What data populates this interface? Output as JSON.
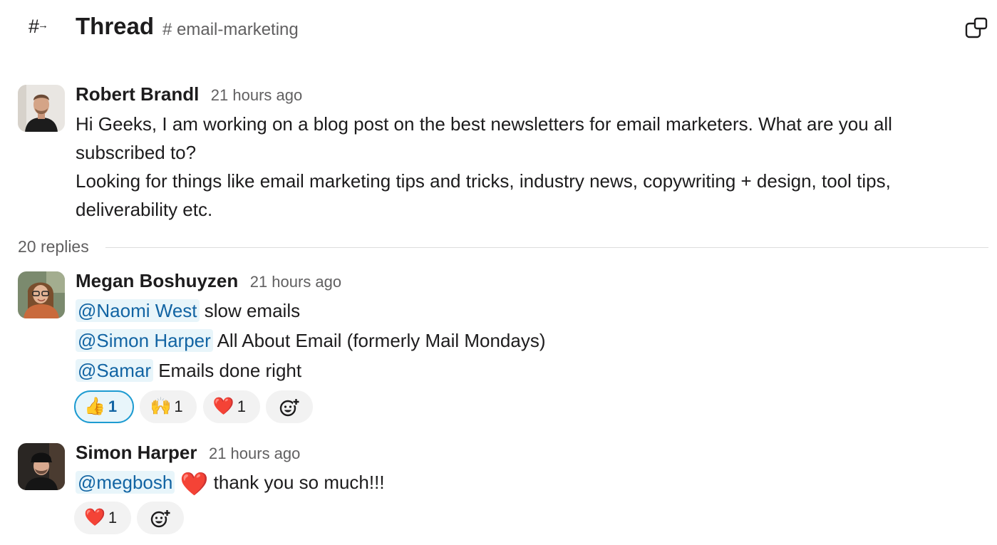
{
  "header": {
    "title": "Thread",
    "channel": "# email-marketing"
  },
  "parent": {
    "author": "Robert Brandl",
    "time": "21 hours ago",
    "text": "Hi Geeks, I am working on a blog post on the best newsletters for email marketers. What are you all subscribed to?\nLooking for things like email marketing tips and tricks, industry news, copywriting + design, tool tips, deliverability etc."
  },
  "replies_label": "20 replies",
  "messages": [
    {
      "author": "Megan Boshuyzen",
      "time": "21 hours ago",
      "lines": [
        {
          "mention": "@Naomi West",
          "text": " slow emails"
        },
        {
          "mention": "@Simon Harper",
          "text": " All About Email (formerly Mail Mondays)"
        },
        {
          "mention": "@Samar",
          "text": " Emails done right"
        }
      ],
      "reactions": [
        {
          "emoji": "👍",
          "count": "1"
        },
        {
          "emoji": "🙌",
          "count": "1"
        },
        {
          "emoji": "❤️",
          "count": "1"
        }
      ]
    },
    {
      "author": "Simon Harper",
      "time": "21 hours ago",
      "lines": [
        {
          "mention": "@megbosh",
          "emoji": "❤️",
          "text": " thank you so much!!!"
        }
      ],
      "reactions": [
        {
          "emoji": "❤️",
          "count": "1"
        }
      ]
    }
  ],
  "icons": {
    "thread": "thread-icon",
    "popout": "popout-icon",
    "add_reaction": "add-reaction-icon"
  },
  "colors": {
    "mention_text": "#1264a3",
    "mention_bg": "#e8f5fa",
    "active_reaction_border": "#1d9bd1"
  }
}
